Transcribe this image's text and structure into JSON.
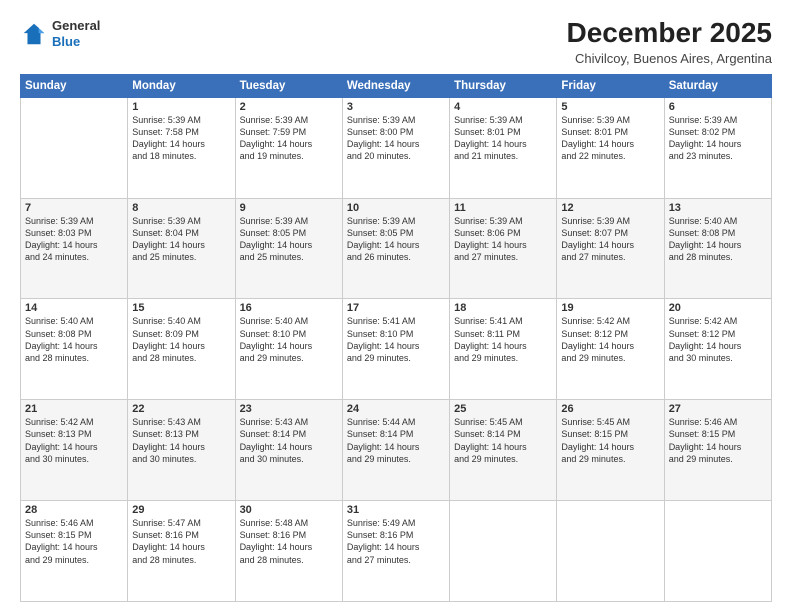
{
  "logo": {
    "general": "General",
    "blue": "Blue"
  },
  "title": "December 2025",
  "subtitle": "Chivilcoy, Buenos Aires, Argentina",
  "weekdays": [
    "Sunday",
    "Monday",
    "Tuesday",
    "Wednesday",
    "Thursday",
    "Friday",
    "Saturday"
  ],
  "weeks": [
    [
      {
        "day": "",
        "info": ""
      },
      {
        "day": "1",
        "info": "Sunrise: 5:39 AM\nSunset: 7:58 PM\nDaylight: 14 hours\nand 18 minutes."
      },
      {
        "day": "2",
        "info": "Sunrise: 5:39 AM\nSunset: 7:59 PM\nDaylight: 14 hours\nand 19 minutes."
      },
      {
        "day": "3",
        "info": "Sunrise: 5:39 AM\nSunset: 8:00 PM\nDaylight: 14 hours\nand 20 minutes."
      },
      {
        "day": "4",
        "info": "Sunrise: 5:39 AM\nSunset: 8:01 PM\nDaylight: 14 hours\nand 21 minutes."
      },
      {
        "day": "5",
        "info": "Sunrise: 5:39 AM\nSunset: 8:01 PM\nDaylight: 14 hours\nand 22 minutes."
      },
      {
        "day": "6",
        "info": "Sunrise: 5:39 AM\nSunset: 8:02 PM\nDaylight: 14 hours\nand 23 minutes."
      }
    ],
    [
      {
        "day": "7",
        "info": "Sunrise: 5:39 AM\nSunset: 8:03 PM\nDaylight: 14 hours\nand 24 minutes."
      },
      {
        "day": "8",
        "info": "Sunrise: 5:39 AM\nSunset: 8:04 PM\nDaylight: 14 hours\nand 25 minutes."
      },
      {
        "day": "9",
        "info": "Sunrise: 5:39 AM\nSunset: 8:05 PM\nDaylight: 14 hours\nand 25 minutes."
      },
      {
        "day": "10",
        "info": "Sunrise: 5:39 AM\nSunset: 8:05 PM\nDaylight: 14 hours\nand 26 minutes."
      },
      {
        "day": "11",
        "info": "Sunrise: 5:39 AM\nSunset: 8:06 PM\nDaylight: 14 hours\nand 27 minutes."
      },
      {
        "day": "12",
        "info": "Sunrise: 5:39 AM\nSunset: 8:07 PM\nDaylight: 14 hours\nand 27 minutes."
      },
      {
        "day": "13",
        "info": "Sunrise: 5:40 AM\nSunset: 8:08 PM\nDaylight: 14 hours\nand 28 minutes."
      }
    ],
    [
      {
        "day": "14",
        "info": "Sunrise: 5:40 AM\nSunset: 8:08 PM\nDaylight: 14 hours\nand 28 minutes."
      },
      {
        "day": "15",
        "info": "Sunrise: 5:40 AM\nSunset: 8:09 PM\nDaylight: 14 hours\nand 28 minutes."
      },
      {
        "day": "16",
        "info": "Sunrise: 5:40 AM\nSunset: 8:10 PM\nDaylight: 14 hours\nand 29 minutes."
      },
      {
        "day": "17",
        "info": "Sunrise: 5:41 AM\nSunset: 8:10 PM\nDaylight: 14 hours\nand 29 minutes."
      },
      {
        "day": "18",
        "info": "Sunrise: 5:41 AM\nSunset: 8:11 PM\nDaylight: 14 hours\nand 29 minutes."
      },
      {
        "day": "19",
        "info": "Sunrise: 5:42 AM\nSunset: 8:12 PM\nDaylight: 14 hours\nand 29 minutes."
      },
      {
        "day": "20",
        "info": "Sunrise: 5:42 AM\nSunset: 8:12 PM\nDaylight: 14 hours\nand 30 minutes."
      }
    ],
    [
      {
        "day": "21",
        "info": "Sunrise: 5:42 AM\nSunset: 8:13 PM\nDaylight: 14 hours\nand 30 minutes."
      },
      {
        "day": "22",
        "info": "Sunrise: 5:43 AM\nSunset: 8:13 PM\nDaylight: 14 hours\nand 30 minutes."
      },
      {
        "day": "23",
        "info": "Sunrise: 5:43 AM\nSunset: 8:14 PM\nDaylight: 14 hours\nand 30 minutes."
      },
      {
        "day": "24",
        "info": "Sunrise: 5:44 AM\nSunset: 8:14 PM\nDaylight: 14 hours\nand 29 minutes."
      },
      {
        "day": "25",
        "info": "Sunrise: 5:45 AM\nSunset: 8:14 PM\nDaylight: 14 hours\nand 29 minutes."
      },
      {
        "day": "26",
        "info": "Sunrise: 5:45 AM\nSunset: 8:15 PM\nDaylight: 14 hours\nand 29 minutes."
      },
      {
        "day": "27",
        "info": "Sunrise: 5:46 AM\nSunset: 8:15 PM\nDaylight: 14 hours\nand 29 minutes."
      }
    ],
    [
      {
        "day": "28",
        "info": "Sunrise: 5:46 AM\nSunset: 8:15 PM\nDaylight: 14 hours\nand 29 minutes."
      },
      {
        "day": "29",
        "info": "Sunrise: 5:47 AM\nSunset: 8:16 PM\nDaylight: 14 hours\nand 28 minutes."
      },
      {
        "day": "30",
        "info": "Sunrise: 5:48 AM\nSunset: 8:16 PM\nDaylight: 14 hours\nand 28 minutes."
      },
      {
        "day": "31",
        "info": "Sunrise: 5:49 AM\nSunset: 8:16 PM\nDaylight: 14 hours\nand 27 minutes."
      },
      {
        "day": "",
        "info": ""
      },
      {
        "day": "",
        "info": ""
      },
      {
        "day": "",
        "info": ""
      }
    ]
  ]
}
